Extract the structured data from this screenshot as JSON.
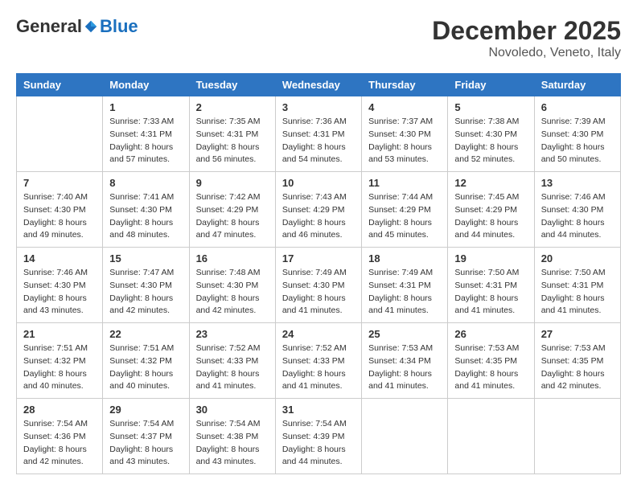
{
  "header": {
    "logo": {
      "general": "General",
      "blue": "Blue"
    },
    "title": "December 2025",
    "location": "Novoledo, Veneto, Italy"
  },
  "calendar": {
    "days_of_week": [
      "Sunday",
      "Monday",
      "Tuesday",
      "Wednesday",
      "Thursday",
      "Friday",
      "Saturday"
    ],
    "weeks": [
      [
        {
          "day": "",
          "info": ""
        },
        {
          "day": "1",
          "info": "Sunrise: 7:33 AM\nSunset: 4:31 PM\nDaylight: 8 hours\nand 57 minutes."
        },
        {
          "day": "2",
          "info": "Sunrise: 7:35 AM\nSunset: 4:31 PM\nDaylight: 8 hours\nand 56 minutes."
        },
        {
          "day": "3",
          "info": "Sunrise: 7:36 AM\nSunset: 4:31 PM\nDaylight: 8 hours\nand 54 minutes."
        },
        {
          "day": "4",
          "info": "Sunrise: 7:37 AM\nSunset: 4:30 PM\nDaylight: 8 hours\nand 53 minutes."
        },
        {
          "day": "5",
          "info": "Sunrise: 7:38 AM\nSunset: 4:30 PM\nDaylight: 8 hours\nand 52 minutes."
        },
        {
          "day": "6",
          "info": "Sunrise: 7:39 AM\nSunset: 4:30 PM\nDaylight: 8 hours\nand 50 minutes."
        }
      ],
      [
        {
          "day": "7",
          "info": "Sunrise: 7:40 AM\nSunset: 4:30 PM\nDaylight: 8 hours\nand 49 minutes."
        },
        {
          "day": "8",
          "info": "Sunrise: 7:41 AM\nSunset: 4:30 PM\nDaylight: 8 hours\nand 48 minutes."
        },
        {
          "day": "9",
          "info": "Sunrise: 7:42 AM\nSunset: 4:29 PM\nDaylight: 8 hours\nand 47 minutes."
        },
        {
          "day": "10",
          "info": "Sunrise: 7:43 AM\nSunset: 4:29 PM\nDaylight: 8 hours\nand 46 minutes."
        },
        {
          "day": "11",
          "info": "Sunrise: 7:44 AM\nSunset: 4:29 PM\nDaylight: 8 hours\nand 45 minutes."
        },
        {
          "day": "12",
          "info": "Sunrise: 7:45 AM\nSunset: 4:29 PM\nDaylight: 8 hours\nand 44 minutes."
        },
        {
          "day": "13",
          "info": "Sunrise: 7:46 AM\nSunset: 4:30 PM\nDaylight: 8 hours\nand 44 minutes."
        }
      ],
      [
        {
          "day": "14",
          "info": "Sunrise: 7:46 AM\nSunset: 4:30 PM\nDaylight: 8 hours\nand 43 minutes."
        },
        {
          "day": "15",
          "info": "Sunrise: 7:47 AM\nSunset: 4:30 PM\nDaylight: 8 hours\nand 42 minutes."
        },
        {
          "day": "16",
          "info": "Sunrise: 7:48 AM\nSunset: 4:30 PM\nDaylight: 8 hours\nand 42 minutes."
        },
        {
          "day": "17",
          "info": "Sunrise: 7:49 AM\nSunset: 4:30 PM\nDaylight: 8 hours\nand 41 minutes."
        },
        {
          "day": "18",
          "info": "Sunrise: 7:49 AM\nSunset: 4:31 PM\nDaylight: 8 hours\nand 41 minutes."
        },
        {
          "day": "19",
          "info": "Sunrise: 7:50 AM\nSunset: 4:31 PM\nDaylight: 8 hours\nand 41 minutes."
        },
        {
          "day": "20",
          "info": "Sunrise: 7:50 AM\nSunset: 4:31 PM\nDaylight: 8 hours\nand 41 minutes."
        }
      ],
      [
        {
          "day": "21",
          "info": "Sunrise: 7:51 AM\nSunset: 4:32 PM\nDaylight: 8 hours\nand 40 minutes."
        },
        {
          "day": "22",
          "info": "Sunrise: 7:51 AM\nSunset: 4:32 PM\nDaylight: 8 hours\nand 40 minutes."
        },
        {
          "day": "23",
          "info": "Sunrise: 7:52 AM\nSunset: 4:33 PM\nDaylight: 8 hours\nand 41 minutes."
        },
        {
          "day": "24",
          "info": "Sunrise: 7:52 AM\nSunset: 4:33 PM\nDaylight: 8 hours\nand 41 minutes."
        },
        {
          "day": "25",
          "info": "Sunrise: 7:53 AM\nSunset: 4:34 PM\nDaylight: 8 hours\nand 41 minutes."
        },
        {
          "day": "26",
          "info": "Sunrise: 7:53 AM\nSunset: 4:35 PM\nDaylight: 8 hours\nand 41 minutes."
        },
        {
          "day": "27",
          "info": "Sunrise: 7:53 AM\nSunset: 4:35 PM\nDaylight: 8 hours\nand 42 minutes."
        }
      ],
      [
        {
          "day": "28",
          "info": "Sunrise: 7:54 AM\nSunset: 4:36 PM\nDaylight: 8 hours\nand 42 minutes."
        },
        {
          "day": "29",
          "info": "Sunrise: 7:54 AM\nSunset: 4:37 PM\nDaylight: 8 hours\nand 43 minutes."
        },
        {
          "day": "30",
          "info": "Sunrise: 7:54 AM\nSunset: 4:38 PM\nDaylight: 8 hours\nand 43 minutes."
        },
        {
          "day": "31",
          "info": "Sunrise: 7:54 AM\nSunset: 4:39 PM\nDaylight: 8 hours\nand 44 minutes."
        },
        {
          "day": "",
          "info": ""
        },
        {
          "day": "",
          "info": ""
        },
        {
          "day": "",
          "info": ""
        }
      ]
    ]
  }
}
